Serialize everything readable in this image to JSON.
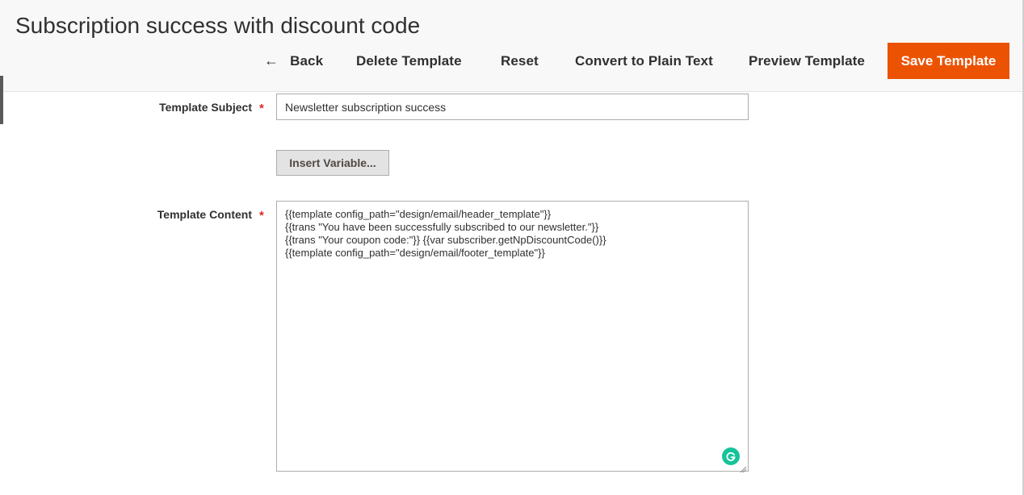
{
  "header": {
    "title": "Subscription success with discount code",
    "toolbar": {
      "back_label": "Back",
      "delete_label": "Delete Template",
      "reset_label": "Reset",
      "convert_label": "Convert to Plain Text",
      "preview_label": "Preview Template",
      "save_label": "Save Template"
    }
  },
  "form": {
    "subject": {
      "label": "Template Subject",
      "required_mark": "*",
      "value": "Newsletter subscription success"
    },
    "insert_variable": {
      "label": "Insert Variable..."
    },
    "content": {
      "label": "Template Content",
      "required_mark": "*",
      "value": "{{template config_path=\"design/email/header_template\"}}\n{{trans \"You have been successfully subscribed to our newsletter.\"}}\n{{trans \"Your coupon code:\"}} {{var subscriber.getNpDiscountCode()}}\n{{template config_path=\"design/email/footer_template\"}}"
    }
  },
  "icons": {
    "back": "arrow-left-icon",
    "grammarly": "grammarly-icon",
    "resize": "resize-handle-icon"
  },
  "colors": {
    "primary_button": "#eb5202",
    "required": "#e22626",
    "grammarly": "#15c39a",
    "header_bg": "#f8f8f8"
  }
}
